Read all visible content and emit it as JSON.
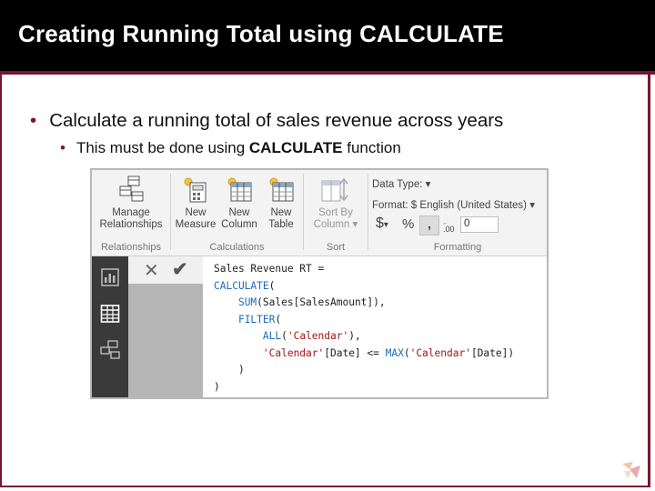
{
  "slide": {
    "title": "Creating Running Total using CALCULATE",
    "bullet1": "Calculate a running total of sales revenue across years",
    "bullet2_prefix": "This must be done using ",
    "bullet2_bold": "CALCULATE",
    "bullet2_suffix": " function",
    "bullet_char": "•"
  },
  "ribbon": {
    "relationships": {
      "manage_line1": "Manage",
      "manage_line2": "Relationships",
      "group_label": "Relationships"
    },
    "calculations": {
      "new_measure_line1": "New",
      "new_measure_line2": "Measure",
      "new_column_line1": "New",
      "new_column_line2": "Column",
      "new_table_line1": "New",
      "new_table_line2": "Table",
      "group_label": "Calculations"
    },
    "sort": {
      "sort_by_line1": "Sort By",
      "sort_by_line2": "Column",
      "dropdown_arrow": "▾",
      "group_label": "Sort"
    },
    "formatting": {
      "data_type_label": "Data Type:",
      "data_type_arrow": "▾",
      "format_label": "Format: $ English (United States)",
      "format_arrow": "▾",
      "currency_symbol": "$",
      "currency_arrow": "▾",
      "percent_symbol": "%",
      "comma_symbol": ",",
      "decimal_value": "0",
      "group_label": "Formatting"
    }
  },
  "formula_bar": {
    "cancel_glyph": "✕",
    "commit_glyph": "✔"
  },
  "code": {
    "line1": "Sales Revenue RT =",
    "line2_fn": "CALCULATE",
    "line2_rest": "(",
    "line3_indent": "    ",
    "line3_fn": "SUM",
    "line3_rest": "(Sales[SalesAmount]),",
    "line4_indent": "    ",
    "line4_fn": "FILTER",
    "line4_rest": "(",
    "line5_indent": "        ",
    "line5_fn": "ALL",
    "line5_open": "(",
    "line5_str": "'Calendar'",
    "line5_close": "),",
    "line6_indent": "        ",
    "line6_str1": "'Calendar'",
    "line6_mid": "[Date] <= ",
    "line6_fn": "MAX",
    "line6_open": "(",
    "line6_str2": "'Calendar'",
    "line6_close": "[Date])",
    "line7": "    )",
    "line8": ")"
  },
  "colors": {
    "title_bg": "#000000",
    "accent": "#7a1430",
    "dax_keyword": "#1e6bb8",
    "dax_string": "#a31515"
  },
  "icons": {
    "manage": "manage-relationships-icon",
    "measure": "new-measure-icon",
    "column": "new-column-icon",
    "table": "new-table-icon",
    "sort": "sort-by-column-icon",
    "report": "report-view-icon",
    "data": "data-view-icon",
    "model": "relationships-view-icon"
  }
}
